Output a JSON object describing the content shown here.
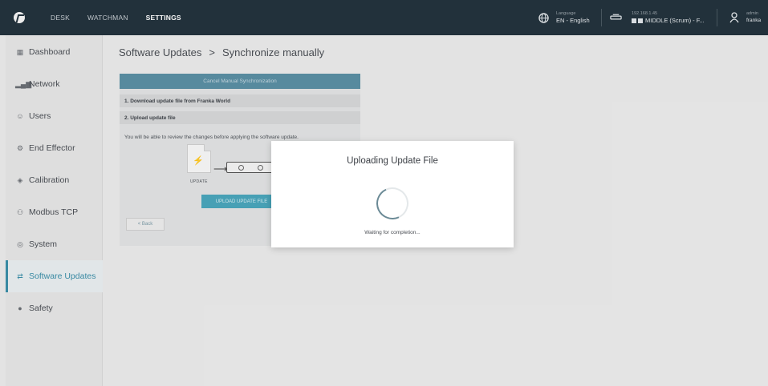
{
  "topbar": {
    "nav": [
      "DESK",
      "WATCHMAN",
      "SETTINGS"
    ],
    "active_nav": "SETTINGS",
    "language": {
      "label": "Language",
      "value": "EN - English"
    },
    "robot": {
      "ip": "192.168.1.45",
      "name": "MIDDLE (Scrum) - F..."
    },
    "user": {
      "role": "admin",
      "name": "franka"
    }
  },
  "sidebar": {
    "items": [
      {
        "label": "Dashboard",
        "icon": "dashboard-icon"
      },
      {
        "label": "Network",
        "icon": "network-icon"
      },
      {
        "label": "Users",
        "icon": "users-icon"
      },
      {
        "label": "End Effector",
        "icon": "end-effector-icon"
      },
      {
        "label": "Calibration",
        "icon": "calibration-icon"
      },
      {
        "label": "Modbus TCP",
        "icon": "modbus-icon"
      },
      {
        "label": "System",
        "icon": "system-icon"
      },
      {
        "label": "Software Updates",
        "icon": "software-updates-icon"
      },
      {
        "label": "Safety",
        "icon": "safety-icon"
      }
    ],
    "active": "Software Updates"
  },
  "page": {
    "breadcrumb_root": "Software Updates",
    "breadcrumb_sep": ">",
    "breadcrumb_current": "Synchronize manually"
  },
  "panel": {
    "cancel_label": "Cancel Manual Synchronization",
    "step1": "1. Download update file from Franka World",
    "step2": "2. Upload update file",
    "description": "You will be able to review the changes before applying the software update.",
    "update_caption": "UPDATE",
    "upload_button": "UPLOAD UPDATE FILE",
    "back_button": "< Back"
  },
  "modal": {
    "title": "Uploading Update File",
    "status": "Waiting for completion..."
  },
  "colors": {
    "topbar": "#24333d",
    "accent": "#3a8ea8",
    "upload_button": "#4aa6bb",
    "cancel_button": "#5a8fa4"
  }
}
